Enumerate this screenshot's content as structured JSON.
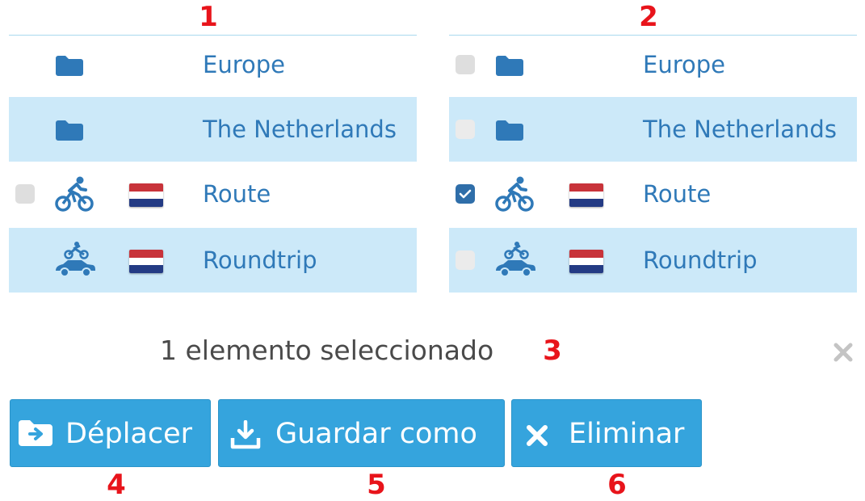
{
  "markers": [
    "1",
    "2",
    "3",
    "4",
    "5",
    "6"
  ],
  "panels": [
    {
      "rows": [
        {
          "label": "Europe",
          "icon": "folder-icon",
          "checkbox": "none"
        },
        {
          "label": "The Netherlands",
          "icon": "folder-icon",
          "checkbox": "none"
        },
        {
          "label": "Route",
          "icon": "bicycle-icon",
          "flag": "netherlands-flag",
          "checkbox": "unchecked"
        },
        {
          "label": "Roundtrip",
          "icon": "motorbike-car-icon",
          "flag": "netherlands-flag",
          "checkbox": "none"
        }
      ]
    },
    {
      "rows": [
        {
          "label": "Europe",
          "icon": "folder-icon",
          "checkbox": "unchecked"
        },
        {
          "label": "The Netherlands",
          "icon": "folder-icon",
          "checkbox": "disabled"
        },
        {
          "label": "Route",
          "icon": "bicycle-icon",
          "flag": "netherlands-flag",
          "checkbox": "checked"
        },
        {
          "label": "Roundtrip",
          "icon": "motorbike-car-icon",
          "flag": "netherlands-flag",
          "checkbox": "disabled"
        }
      ]
    }
  ],
  "selection": {
    "status": "1 elemento seleccionado"
  },
  "actions": {
    "move_label": "Déplacer",
    "save_as_label": "Guardar como",
    "delete_label": "Eliminar"
  },
  "colors": {
    "accent": "#35a4dd",
    "icon": "#2f79b8",
    "row_highlight": "#cce9f9",
    "marker": "#e8141b",
    "flag_red": "#c8333a",
    "flag_white": "#ffffff",
    "flag_blue": "#243b84"
  }
}
